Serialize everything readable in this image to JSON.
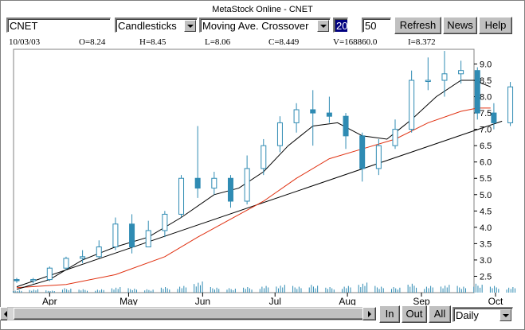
{
  "window": {
    "title": "MetaStock Online - CNET"
  },
  "toolbar": {
    "symbol": "CNET",
    "chart_style": "Candlesticks",
    "indicator": "Moving Ave. Crossover",
    "param_fast": "20",
    "param_slow": "50",
    "refresh_label": "Refresh",
    "news_label": "News",
    "help_label": "Help"
  },
  "info": {
    "date": "10/03/03",
    "open": "O=8.24",
    "high": "H=8.45",
    "low": "L=8.06",
    "close": "C=8.449",
    "volume": "V=168860.0",
    "interest": "I=8.372"
  },
  "bottom": {
    "zoom_in_label": "In",
    "zoom_out_label": "Out",
    "all_label": "All",
    "period": "Daily"
  },
  "colors": {
    "candle": "#2f8bb3",
    "ma_fast": "#000000",
    "ma_slow": "#e03010",
    "trendline": "#000000",
    "volume": "#2f8bb3"
  },
  "chart_data": {
    "type": "candlestick",
    "symbol": "CNET",
    "x_ticks": [
      "Apr",
      "May",
      "Jun",
      "Jul",
      "Aug",
      "Sep",
      "Oct"
    ],
    "y_ticks": [
      2.5,
      3.0,
      3.5,
      4.0,
      4.5,
      5.0,
      5.5,
      6.0,
      6.5,
      7.0,
      7.5,
      8.0,
      8.5,
      9.0
    ],
    "ylim": [
      2.0,
      9.45
    ],
    "x_domain": [
      0,
      27.6
    ],
    "x_units": "weeks since first bar (2003-03-17)",
    "month_tick_positions": [
      2,
      6.8,
      11.3,
      15.7,
      20.1,
      24.6,
      29.1
    ],
    "weekly_ohlc": [
      {
        "o": 2.4,
        "h": 2.45,
        "l": 2.3,
        "c": 2.38
      },
      {
        "o": 2.38,
        "h": 2.45,
        "l": 2.28,
        "c": 2.4
      },
      {
        "o": 2.4,
        "h": 2.8,
        "l": 2.35,
        "c": 2.75
      },
      {
        "o": 2.75,
        "h": 3.1,
        "l": 2.7,
        "c": 3.05
      },
      {
        "o": 3.05,
        "h": 3.3,
        "l": 2.9,
        "c": 3.1
      },
      {
        "o": 3.1,
        "h": 3.6,
        "l": 3.05,
        "c": 3.4
      },
      {
        "o": 3.4,
        "h": 4.3,
        "l": 3.3,
        "c": 4.1
      },
      {
        "o": 4.1,
        "h": 4.4,
        "l": 3.2,
        "c": 3.4
      },
      {
        "o": 3.4,
        "h": 4.2,
        "l": 3.4,
        "c": 3.9
      },
      {
        "o": 3.9,
        "h": 4.5,
        "l": 3.7,
        "c": 4.4
      },
      {
        "o": 4.4,
        "h": 5.6,
        "l": 4.3,
        "c": 5.5
      },
      {
        "o": 5.5,
        "h": 7.1,
        "l": 4.9,
        "c": 5.2
      },
      {
        "o": 5.2,
        "h": 5.7,
        "l": 5.0,
        "c": 5.5
      },
      {
        "o": 5.5,
        "h": 5.6,
        "l": 4.6,
        "c": 4.8
      },
      {
        "o": 4.8,
        "h": 6.2,
        "l": 4.7,
        "c": 5.8
      },
      {
        "o": 5.8,
        "h": 6.7,
        "l": 5.6,
        "c": 6.5
      },
      {
        "o": 6.5,
        "h": 7.4,
        "l": 6.3,
        "c": 7.2
      },
      {
        "o": 7.2,
        "h": 7.8,
        "l": 6.9,
        "c": 7.6
      },
      {
        "o": 7.6,
        "h": 8.2,
        "l": 6.5,
        "c": 7.5
      },
      {
        "o": 7.5,
        "h": 8.0,
        "l": 7.2,
        "c": 7.4
      },
      {
        "o": 7.4,
        "h": 7.5,
        "l": 6.4,
        "c": 6.8
      },
      {
        "o": 6.8,
        "h": 6.9,
        "l": 5.4,
        "c": 5.8
      },
      {
        "o": 5.8,
        "h": 6.7,
        "l": 5.6,
        "c": 6.5
      },
      {
        "o": 6.5,
        "h": 7.3,
        "l": 6.4,
        "c": 7.0
      },
      {
        "o": 7.0,
        "h": 8.8,
        "l": 6.9,
        "c": 8.5
      },
      {
        "o": 8.5,
        "h": 9.2,
        "l": 8.2,
        "c": 8.5
      },
      {
        "o": 8.5,
        "h": 9.4,
        "l": 8.0,
        "c": 8.7
      },
      {
        "o": 8.7,
        "h": 9.1,
        "l": 8.4,
        "c": 8.8
      },
      {
        "o": 8.8,
        "h": 8.9,
        "l": 7.3,
        "c": 7.5
      },
      {
        "o": 7.5,
        "h": 7.8,
        "l": 7.0,
        "c": 7.2
      },
      {
        "o": 7.2,
        "h": 8.45,
        "l": 7.1,
        "c": 8.3
      }
    ],
    "ma_fast_points": [
      [
        0,
        2.1
      ],
      [
        2,
        2.4
      ],
      [
        4,
        3.0
      ],
      [
        6,
        3.4
      ],
      [
        8,
        3.7
      ],
      [
        10,
        4.3
      ],
      [
        12,
        5.0
      ],
      [
        13.5,
        5.2
      ],
      [
        15,
        5.7
      ],
      [
        16.5,
        6.5
      ],
      [
        18,
        7.1
      ],
      [
        19.5,
        7.2
      ],
      [
        21,
        6.8
      ],
      [
        22.5,
        6.7
      ],
      [
        24,
        7.3
      ],
      [
        25.5,
        8.0
      ],
      [
        27,
        8.5
      ],
      [
        27.8,
        8.5
      ],
      [
        28.8,
        8.3
      ]
    ],
    "ma_slow_points": [
      [
        0,
        2.15
      ],
      [
        3,
        2.25
      ],
      [
        6,
        2.55
      ],
      [
        9,
        3.1
      ],
      [
        11,
        3.7
      ],
      [
        13,
        4.25
      ],
      [
        15,
        4.8
      ],
      [
        17,
        5.5
      ],
      [
        19,
        6.1
      ],
      [
        21,
        6.4
      ],
      [
        23,
        6.7
      ],
      [
        25,
        7.2
      ],
      [
        27,
        7.55
      ],
      [
        28,
        7.65
      ],
      [
        28.8,
        7.65
      ]
    ],
    "trendline": [
      [
        0,
        2.18
      ],
      [
        29.5,
        7.25
      ]
    ],
    "volume_rel": [
      0.2,
      0.3,
      0.2,
      0.4,
      0.3,
      0.3,
      0.5,
      0.4,
      0.3,
      0.5,
      0.6,
      1.0,
      0.5,
      0.4,
      0.5,
      0.6,
      0.7,
      0.6,
      0.7,
      0.5,
      0.6,
      0.9,
      0.6,
      0.5,
      0.8,
      0.6,
      0.7,
      0.6,
      0.8,
      0.6,
      0.5
    ]
  }
}
